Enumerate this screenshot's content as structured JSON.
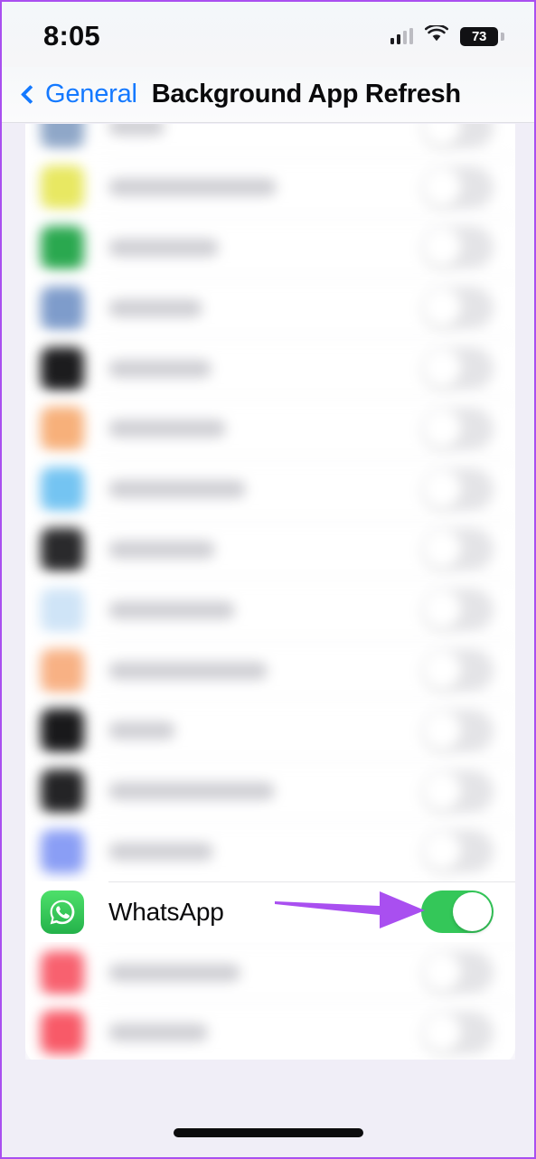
{
  "status_bar": {
    "time": "8:05",
    "battery_percent": "73",
    "cellular_icon": "cellular-signal-icon",
    "wifi_icon": "wifi-icon",
    "battery_icon": "battery-icon"
  },
  "nav_bar": {
    "back_label": "General",
    "back_icon": "chevron-left-icon",
    "title": "Background App Refresh"
  },
  "colors": {
    "accent_blue": "#1479ff",
    "toggle_on_green": "#34c759",
    "toggle_off_gray": "#e4e4e7",
    "annotation_purple": "#a94ff0",
    "page_background": "#f0eef7",
    "list_background": "#ffffff"
  },
  "annotation": {
    "type": "arrow",
    "direction": "right",
    "color": "#a94ff0",
    "points_to": "whatsapp-toggle"
  },
  "list": {
    "rows": [
      {
        "label": "",
        "label_blurred": true,
        "label_width": 62,
        "icon_color": "#8fa7c8",
        "icon_name": "app-icon-blurred",
        "toggle": "off",
        "blurred": true,
        "partial": true
      },
      {
        "label": "",
        "label_blurred": true,
        "label_width": 186,
        "icon_color": "#e8e862",
        "icon_name": "app-icon-blurred",
        "toggle": "off",
        "blurred": true
      },
      {
        "label": "",
        "label_blurred": true,
        "label_width": 122,
        "icon_color": "#2aa84f",
        "icon_name": "app-icon-blurred",
        "toggle": "off",
        "blurred": true
      },
      {
        "label": "",
        "label_blurred": true,
        "label_width": 104,
        "icon_color": "#7e9ccb",
        "icon_name": "app-icon-blurred",
        "toggle": "off",
        "blurred": true
      },
      {
        "label": "",
        "label_blurred": true,
        "label_width": 114,
        "icon_color": "#1c1c1e",
        "icon_name": "app-icon-blurred",
        "toggle": "off",
        "blurred": true
      },
      {
        "label": "",
        "label_blurred": true,
        "label_width": 130,
        "icon_color": "#f7b07a",
        "icon_name": "app-icon-blurred",
        "toggle": "off",
        "blurred": true
      },
      {
        "label": "",
        "label_blurred": true,
        "label_width": 152,
        "icon_color": "#74c4f2",
        "icon_name": "app-icon-blurred",
        "toggle": "off",
        "blurred": true
      },
      {
        "label": "",
        "label_blurred": true,
        "label_width": 118,
        "icon_color": "#2a2a2c",
        "icon_name": "app-icon-blurred",
        "toggle": "off",
        "blurred": true
      },
      {
        "label": "",
        "label_blurred": true,
        "label_width": 140,
        "icon_color": "#cfe4f7",
        "icon_name": "app-icon-blurred",
        "toggle": "off",
        "blurred": true
      },
      {
        "label": "",
        "label_blurred": true,
        "label_width": 176,
        "icon_color": "#f8b184",
        "icon_name": "app-icon-blurred",
        "toggle": "off",
        "blurred": true
      },
      {
        "label": "",
        "label_blurred": true,
        "label_width": 74,
        "icon_color": "#19191b",
        "icon_name": "app-icon-blurred",
        "toggle": "off",
        "blurred": true
      },
      {
        "label": "",
        "label_blurred": true,
        "label_width": 184,
        "icon_color": "#242426",
        "icon_name": "app-icon-blurred",
        "toggle": "off",
        "blurred": true
      },
      {
        "label": "",
        "label_blurred": true,
        "label_width": 116,
        "icon_color": "#8a9ef5",
        "icon_name": "app-icon-blurred",
        "toggle": "off",
        "blurred": true
      },
      {
        "label": "WhatsApp",
        "label_blurred": false,
        "label_width": 0,
        "icon_color": "#25d366",
        "icon_name": "whatsapp-icon",
        "toggle": "on",
        "blurred": false,
        "focus": true
      },
      {
        "label": "",
        "label_blurred": true,
        "label_width": 146,
        "icon_color": "#f8616f",
        "icon_name": "app-icon-blurred",
        "toggle": "off",
        "blurred": true
      },
      {
        "label": "",
        "label_blurred": true,
        "label_width": 110,
        "icon_color": "#f85a68",
        "icon_name": "app-icon-blurred",
        "toggle": "off",
        "blurred": true
      }
    ]
  },
  "home_indicator": {
    "name": "home-indicator"
  }
}
